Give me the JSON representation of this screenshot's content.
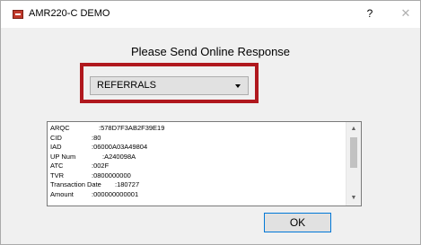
{
  "window": {
    "title": "AMR220-C DEMO",
    "help_label": "?",
    "close_label": "✕"
  },
  "heading": "Please Send Online Response",
  "dropdown": {
    "selected": "REFERRALS"
  },
  "response_fields": [
    {
      "key": "ARQC",
      "value": ":578D7F3AB2F39E19"
    },
    {
      "key": "CID",
      "value": ":80"
    },
    {
      "key": "IAD",
      "value": ":06000A03A49804"
    },
    {
      "key": "UP Num",
      "value": ":A240098A"
    },
    {
      "key": "ATC",
      "value": ":002F"
    },
    {
      "key": "TVR",
      "value": ":0800000000"
    },
    {
      "key": "Transaction Date",
      "value": ":180727"
    },
    {
      "key": "Amount",
      "value": ":000000000001"
    }
  ],
  "ok_button": {
    "label": "OK"
  },
  "colors": {
    "highlight": "#b0181e",
    "focus_border": "#0078d7"
  }
}
